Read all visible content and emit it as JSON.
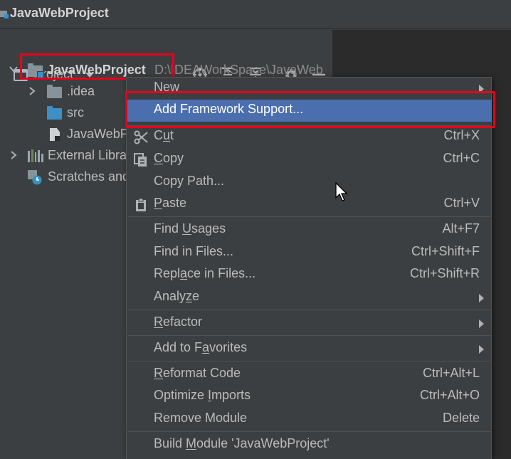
{
  "window": {
    "title": "JavaWebProject",
    "icon": "module-folder-icon"
  },
  "project_panel": {
    "title": "Project",
    "toolbar": [
      {
        "name": "locate-icon",
        "label": "Select Opened File"
      },
      {
        "name": "expand-all-icon",
        "label": "Expand All"
      },
      {
        "name": "collapse-all-icon",
        "label": "Collapse All"
      },
      {
        "name": "gear-icon",
        "label": "Options"
      },
      {
        "name": "hide-icon",
        "label": "Hide"
      }
    ],
    "tree": {
      "root": {
        "label": "JavaWebProject",
        "path": "D:\\IDEAWorkSpace\\JavaWeb"
      },
      "children": [
        {
          "label": ".idea",
          "icon": "folder-icon"
        },
        {
          "label": "src",
          "icon": "source-folder-icon"
        },
        {
          "label": "JavaWebP",
          "icon": "iml-file-icon"
        }
      ],
      "external": {
        "label": "External Libra",
        "icon": "library-icon"
      },
      "scratches": {
        "label": "Scratches and",
        "icon": "scratches-icon"
      }
    }
  },
  "context_menu": {
    "new": {
      "label": "New"
    },
    "add_framework": {
      "label": "Add Framework Support..."
    },
    "cut": {
      "pre": "C",
      "mn": "u",
      "post": "t",
      "shortcut": "Ctrl+X"
    },
    "copy": {
      "pre": "",
      "mn": "C",
      "post": "opy",
      "shortcut": "Ctrl+C"
    },
    "copy_path": {
      "label": "Copy Path..."
    },
    "paste": {
      "pre": "",
      "mn": "P",
      "post": "aste",
      "shortcut": "Ctrl+V"
    },
    "find_usages": {
      "pre": "Find ",
      "mn": "U",
      "post": "sages",
      "shortcut": "Alt+F7"
    },
    "find_in_files": {
      "label": "Find in Files...",
      "shortcut": "Ctrl+Shift+F"
    },
    "replace_in_files": {
      "pre": "Repl",
      "mn": "a",
      "post": "ce in Files...",
      "shortcut": "Ctrl+Shift+R"
    },
    "analyze": {
      "pre": "Analy",
      "mn": "z",
      "post": "e"
    },
    "refactor": {
      "pre": "",
      "mn": "R",
      "post": "efactor"
    },
    "add_to_favorites": {
      "pre": "Add to F",
      "mn": "a",
      "post": "vorites"
    },
    "reformat_code": {
      "pre": "",
      "mn": "R",
      "post": "eformat Code",
      "shortcut": "Ctrl+Alt+L"
    },
    "optimize_imports": {
      "pre": "Optimize ",
      "mn": "I",
      "post": "mports",
      "shortcut": "Ctrl+Alt+O"
    },
    "remove_module": {
      "label": "Remove Module",
      "shortcut": "Delete"
    },
    "build_module": {
      "pre": "Build ",
      "mn": "M",
      "post": "odule 'JavaWebProject'"
    }
  },
  "colors": {
    "background": "#3c3f41",
    "editor": "#2b2b2b",
    "selection": "#4b6eaf",
    "annotation_red": "#e8001c",
    "text": "#bbbbbb"
  }
}
